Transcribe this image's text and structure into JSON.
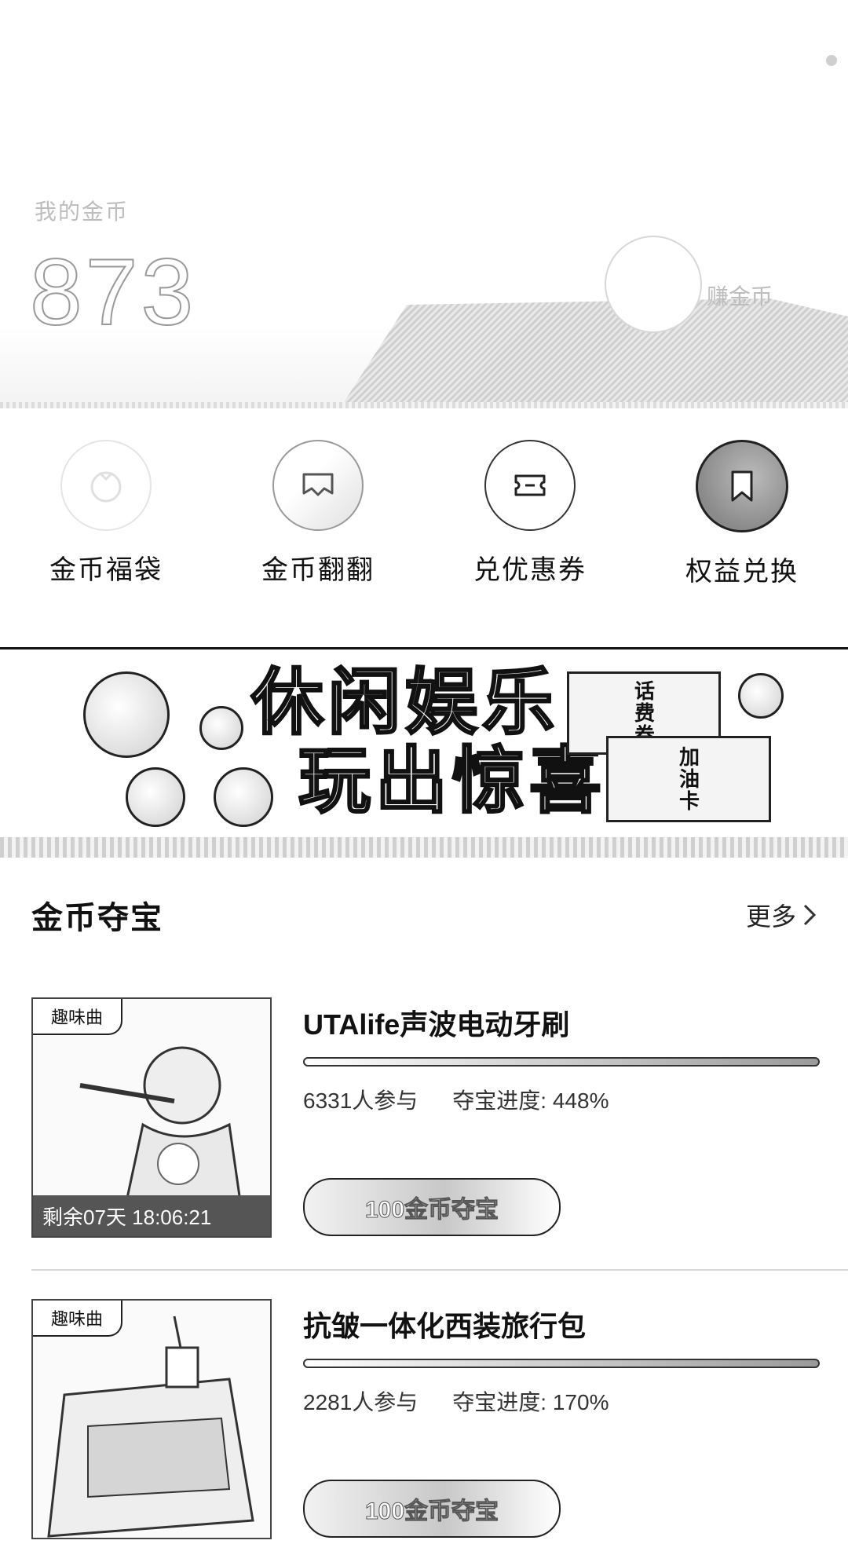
{
  "header": {
    "coins_label": "我的金币",
    "coins_value": "873",
    "earn_link": "赚金币"
  },
  "quick_actions": [
    {
      "label": "金币福袋",
      "icon": "lucky-bag-icon"
    },
    {
      "label": "金币翻翻",
      "icon": "flip-card-icon"
    },
    {
      "label": "兑优惠券",
      "icon": "coupon-icon"
    },
    {
      "label": "权益兑换",
      "icon": "bookmark-icon"
    }
  ],
  "banner": {
    "line1": "休闲娱乐",
    "line2": "玩出惊喜",
    "ticket1": "话费券",
    "ticket2": "加油卡"
  },
  "section": {
    "title": "金币夺宝",
    "more": "更多"
  },
  "products": [
    {
      "badge": "趣味曲",
      "timer": "剩余07天 18:06:21",
      "title": "UTAlife声波电动牙刷",
      "participants": "6331人参与",
      "progress": "夺宝进度: 448%",
      "cta": "100金币夺宝"
    },
    {
      "badge": "趣味曲",
      "timer": "",
      "title": "抗皱一体化西装旅行包",
      "participants": "2281人参与",
      "progress": "夺宝进度: 170%",
      "cta": "100金币夺宝"
    }
  ]
}
